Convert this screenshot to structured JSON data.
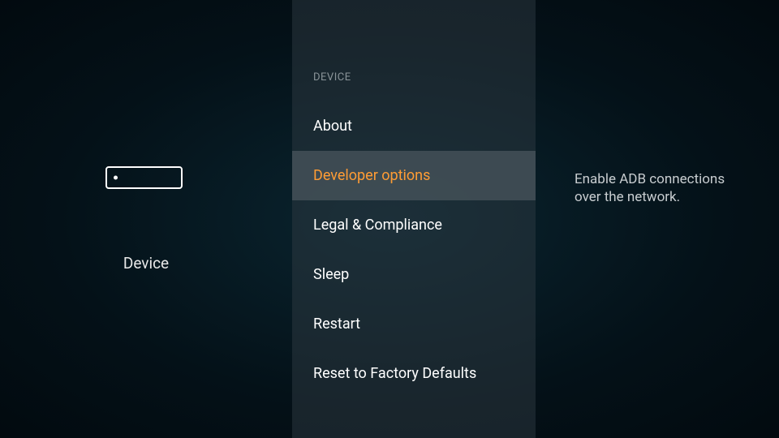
{
  "left": {
    "category_label": "Device"
  },
  "middle": {
    "header": "DEVICE",
    "items": [
      {
        "label": "About"
      },
      {
        "label": "Developer options"
      },
      {
        "label": "Legal & Compliance"
      },
      {
        "label": "Sleep"
      },
      {
        "label": "Restart"
      },
      {
        "label": "Reset to Factory Defaults"
      }
    ]
  },
  "right": {
    "description": "Enable ADB connections over the network."
  }
}
